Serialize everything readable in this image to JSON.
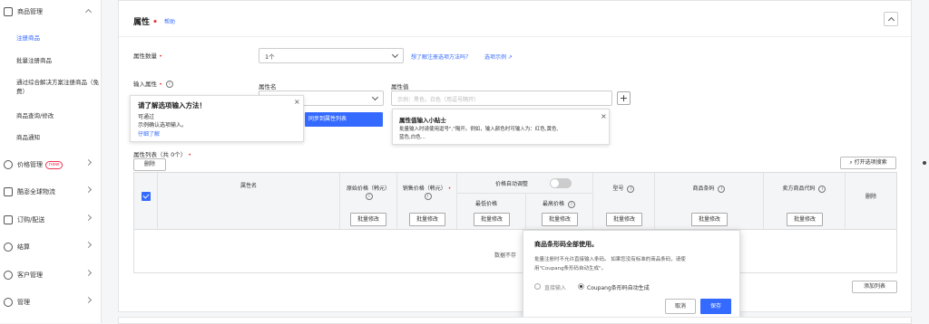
{
  "sidebar": {
    "sections": [
      {
        "label": "商品管理",
        "icon": "box-icon"
      },
      {
        "label": "价格管理",
        "icon": "tag-icon",
        "badge": "new"
      },
      {
        "label": "酷澎全球物流",
        "icon": "truck-icon"
      },
      {
        "label": "订购/配送",
        "icon": "cart-icon"
      },
      {
        "label": "结算",
        "icon": "won-icon"
      },
      {
        "label": "客户管理",
        "icon": "smile-icon"
      },
      {
        "label": "管理",
        "icon": "gear-icon"
      }
    ],
    "sub_items": [
      "注册商品",
      "批量注册商品",
      "通过综合解决方案注册商品（免费）",
      "商品查询/修改",
      "商品通知"
    ]
  },
  "header": {
    "title": "属性",
    "required_mark": "•",
    "help": "帮助"
  },
  "form": {
    "attr_count_label": "属性数量",
    "attr_count_value": "1个",
    "learn_link": "想了解注册选项方法吗？",
    "example_link": "选项示例",
    "input_attr_label": "输入属性",
    "attr_name_label": "属性名",
    "attr_value_label": "属性值",
    "attr_value_placeholder": "示例：黑色，白色（用逗号隔开）",
    "plus": "+"
  },
  "popover_method": {
    "title": "请了解选项输入方法！",
    "line1": "可通过",
    "line2": "示例确认选项输入。",
    "link": "仔细了解"
  },
  "sync_button": "同步到属性列表",
  "tip": {
    "title": "属性值输入小贴士",
    "body1": "批量输入时请使用逗号\",\"隔开。例如，输入颜色时可输入为：红色,黄色,",
    "body2": "蓝色,白色..."
  },
  "list": {
    "label": "属性列表（共 0个）",
    "delete": "删除",
    "search": "打开选项搜索",
    "add_list": "添加列表"
  },
  "table": {
    "col_name": "属性名",
    "col_orig": "原始价格（韩元）",
    "col_sale": "销售价格（韩元）",
    "col_auto": "价格自动调整",
    "col_min": "最低价格",
    "col_max": "最高价格",
    "col_model": "型号",
    "col_barcode": "商品条码",
    "col_seller": "卖方商品代码",
    "col_delete": "删除",
    "batch": "批量修改",
    "empty": "数据不存"
  },
  "dialog": {
    "title": "商品条形码全部使用。",
    "body1": "批量注册时不允许直接输入条码。 如果您没有标准的商品条码，请使",
    "body2": "用\"Coupang条形码自动生成\"。",
    "opt_direct": "直接输入",
    "opt_auto": "Coupang条形码自动生成",
    "cancel": "取消",
    "save": "保存"
  },
  "colors": {
    "accent": "#346aff",
    "required": "#e33"
  }
}
